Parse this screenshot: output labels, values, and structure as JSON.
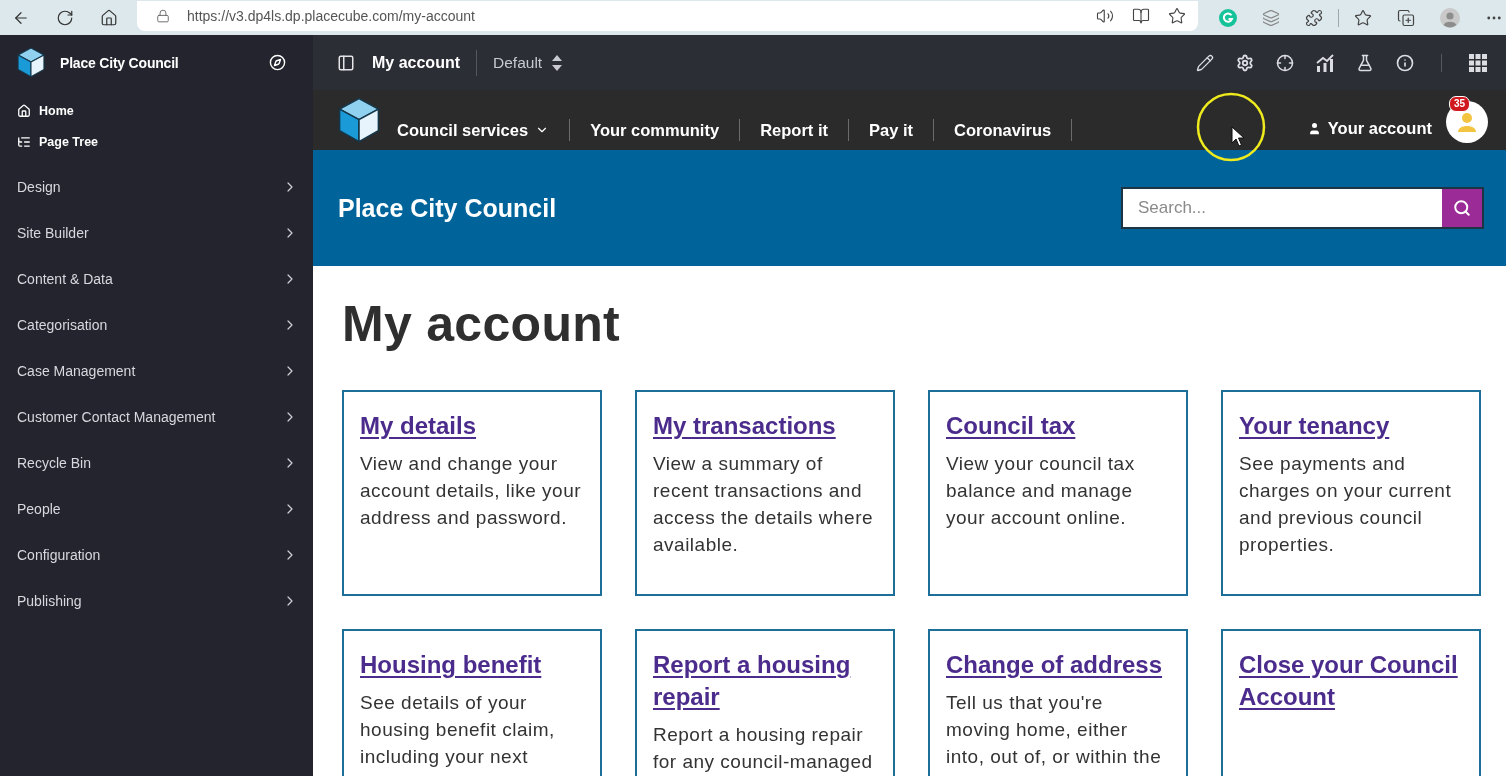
{
  "browser": {
    "url": "https://v3.dp4ls.dp.placecube.com/my-account"
  },
  "sidebar": {
    "title": "Place City Council",
    "quick_links": [
      {
        "kind": "home",
        "label": "Home"
      },
      {
        "kind": "tree",
        "label": "Page Tree"
      }
    ],
    "items": [
      {
        "label": "Design"
      },
      {
        "label": "Site Builder"
      },
      {
        "label": "Content & Data"
      },
      {
        "label": "Categorisation"
      },
      {
        "label": "Case Management"
      },
      {
        "label": "Customer Contact Management"
      },
      {
        "label": "Recycle Bin"
      },
      {
        "label": "People"
      },
      {
        "label": "Configuration"
      },
      {
        "label": "Publishing"
      }
    ]
  },
  "admin_bar": {
    "page_title": "My account",
    "variant": "Default"
  },
  "site_nav": {
    "items": [
      {
        "label": "Council services",
        "has_menu": true
      },
      {
        "label": "Your community",
        "has_menu": false
      },
      {
        "label": "Report it",
        "has_menu": false
      },
      {
        "label": "Pay it",
        "has_menu": false
      },
      {
        "label": "Coronavirus",
        "has_menu": false
      }
    ],
    "account": {
      "label": "Your account",
      "badge": "35"
    }
  },
  "banner": {
    "title": "Place City Council",
    "search": {
      "placeholder": "Search..."
    }
  },
  "page": {
    "heading": "My account",
    "cards": [
      {
        "title": "My details",
        "description": "View and change your account details, like your address and password."
      },
      {
        "title": "My transactions",
        "description": "View a summary of recent transactions and access the details where available."
      },
      {
        "title": "Council tax",
        "description": "View your council tax balance and manage your account online."
      },
      {
        "title": "Your tenancy",
        "description": "See payments and charges on your current and previous council properties."
      },
      {
        "title": "Housing benefit",
        "description": "See details of your housing benefit claim, including your next"
      },
      {
        "title": "Report a housing repair",
        "description": "Report a housing repair for any council-managed"
      },
      {
        "title": "Change of address",
        "description": "Tell us that you're moving home, either into, out of, or within the"
      },
      {
        "title": "Close your Council Account"
      }
    ]
  }
}
